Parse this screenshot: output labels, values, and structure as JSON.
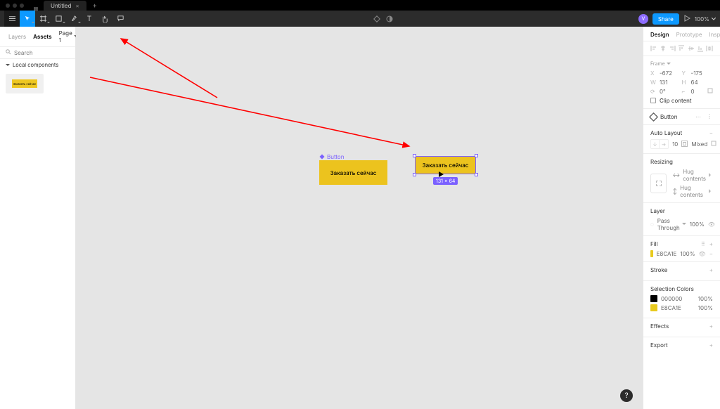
{
  "titlebar": {
    "tab_title": "Untitled",
    "plus": "+"
  },
  "toolbar": {
    "zoom": "100%",
    "share": "Share",
    "avatar_initial": "V"
  },
  "left_panel": {
    "tabs": {
      "layers": "Layers",
      "assets": "Assets"
    },
    "page": "Page 1",
    "search_placeholder": "Search",
    "section": "Local components",
    "asset_preview_text": "Заказать сейчас"
  },
  "canvas": {
    "component_label": "Button",
    "master_text": "Заказать сейчас",
    "instance_text": "Заказать сейчас",
    "dimensions_badge": "131 × 64"
  },
  "right": {
    "tabs": {
      "design": "Design",
      "prototype": "Prototype",
      "inspect": "Inspect"
    },
    "frame": {
      "title": "Frame",
      "x": "-672",
      "y": "-175",
      "w": "131",
      "h": "64",
      "rot": "0°",
      "rad": "0",
      "clip": "Clip content"
    },
    "component": {
      "name": "Button"
    },
    "autolayout": {
      "title": "Auto Layout",
      "gap": "10",
      "padding": "Mixed"
    },
    "resizing": {
      "title": "Resizing",
      "h": "Hug contents",
      "v": "Hug contents"
    },
    "layer": {
      "title": "Layer",
      "mode": "Pass Through",
      "opacity": "100%"
    },
    "fill": {
      "title": "Fill",
      "hex": "E8CA1E",
      "opacity": "100%"
    },
    "stroke": {
      "title": "Stroke"
    },
    "selection_colors": {
      "title": "Selection Colors",
      "items": [
        {
          "hex": "000000",
          "swatch": "#000000",
          "opacity": "100%"
        },
        {
          "hex": "E8CA1E",
          "swatch": "#e8ca1e",
          "opacity": "100%"
        }
      ]
    },
    "effects": "Effects",
    "export": "Export"
  },
  "help": "?"
}
